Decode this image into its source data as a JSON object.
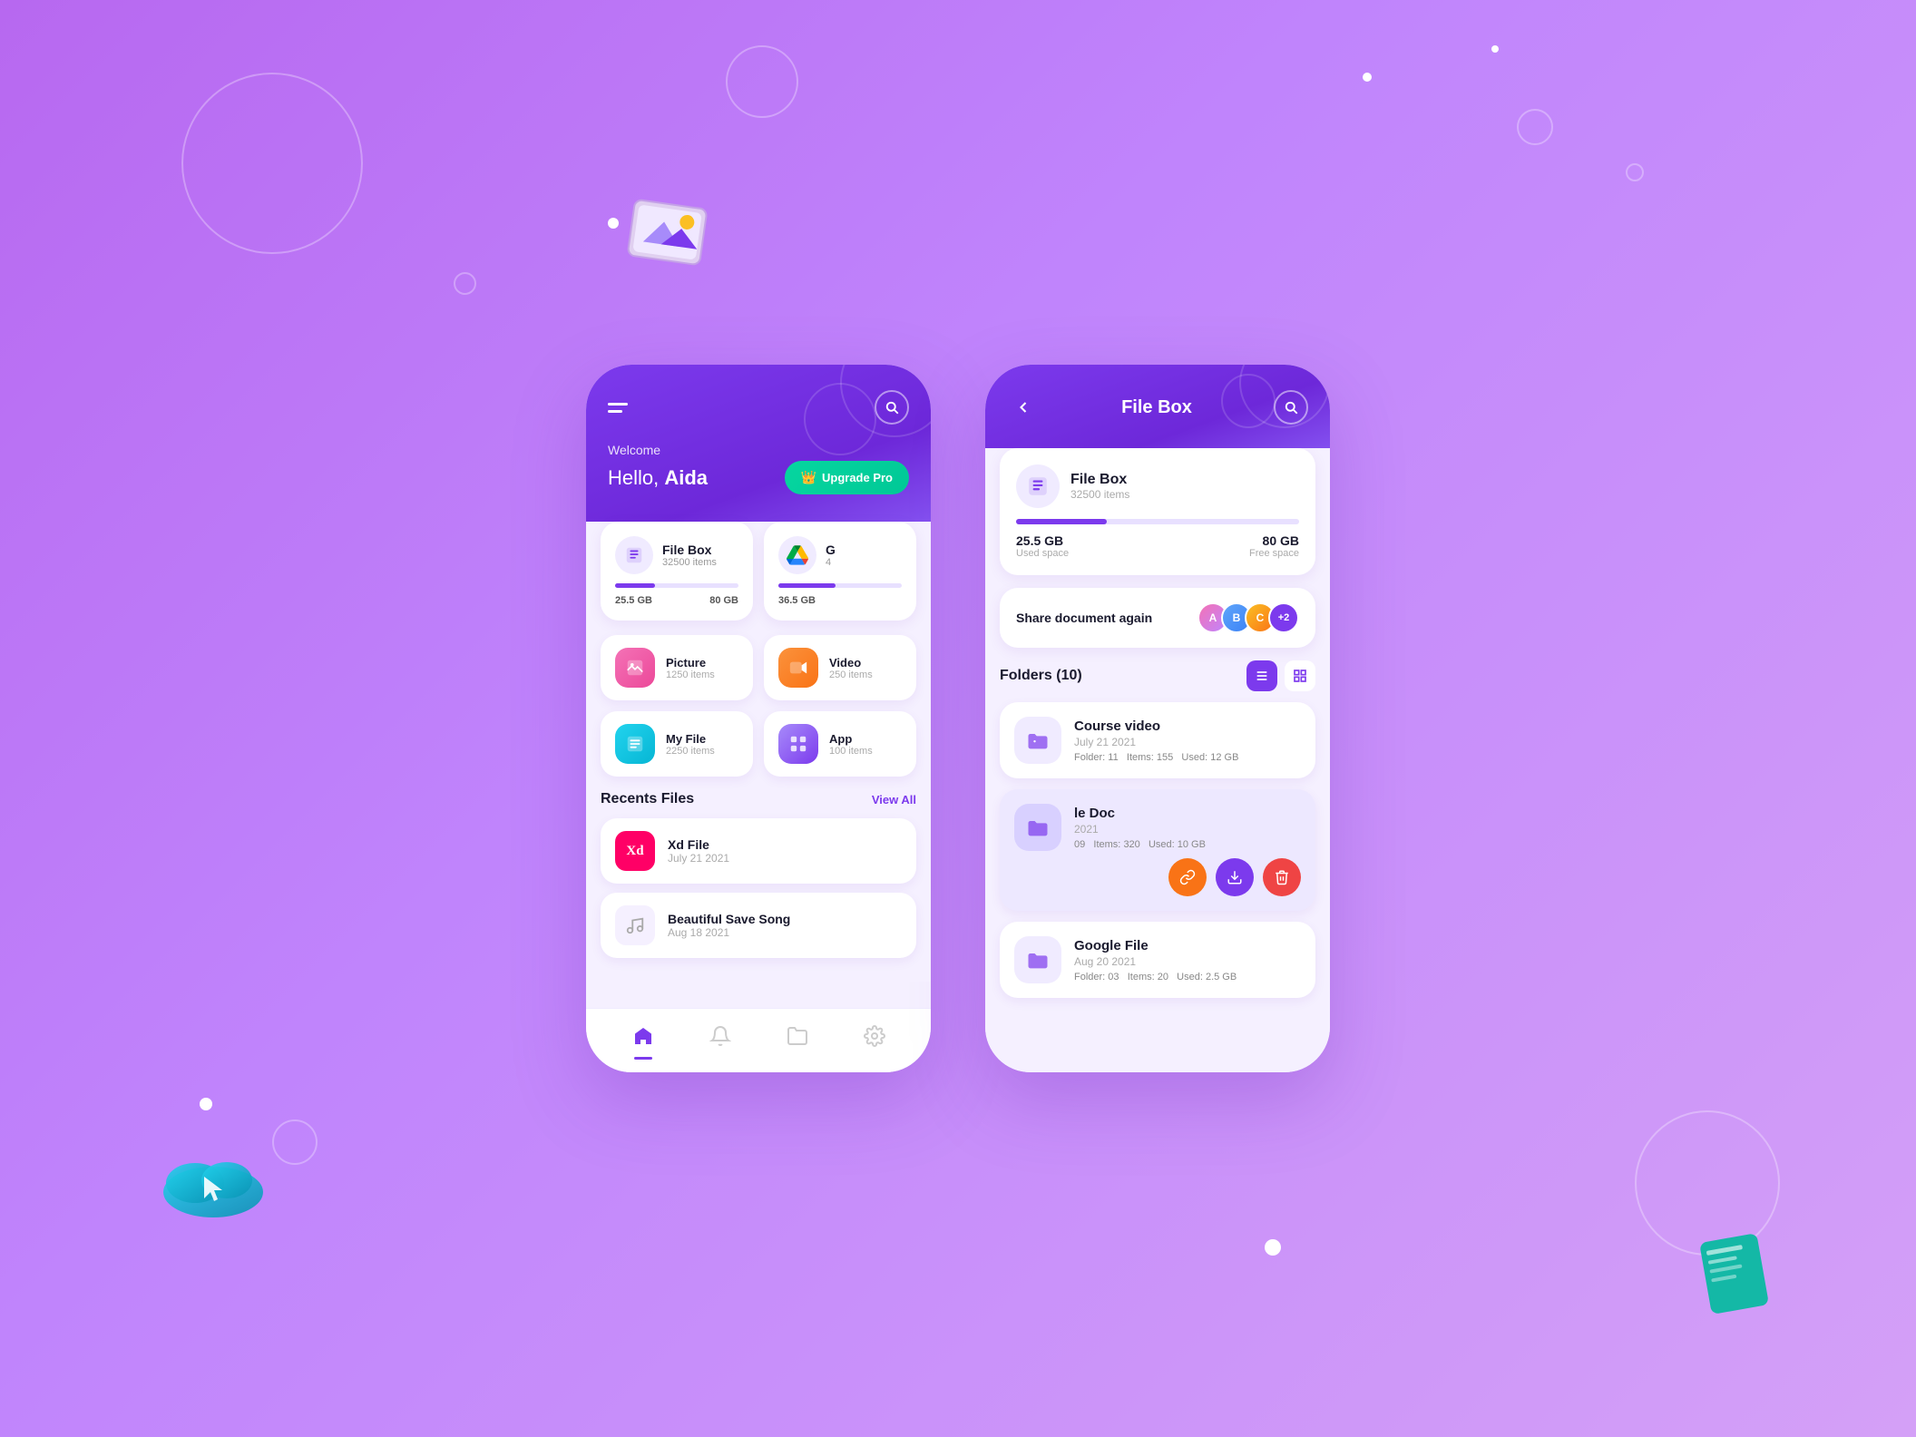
{
  "background": {
    "color": "#c084fc"
  },
  "left_phone": {
    "header": {
      "welcome": "Welcome",
      "hello_prefix": "Hello, ",
      "hello_name": "Aida",
      "upgrade_btn": "Upgrade Pro"
    },
    "storage_cards": [
      {
        "icon": "📄",
        "title": "File Box",
        "subtitle": "32500 items",
        "used_gb": "25.5 GB",
        "free_gb": "80 GB",
        "bar_percent": 32
      },
      {
        "icon": "△",
        "title": "G",
        "subtitle": "4",
        "used_gb": "36.5 GB",
        "free_gb": "",
        "bar_percent": 46
      }
    ],
    "categories": [
      {
        "icon": "🖼",
        "icon_class": "cat-icon-pink",
        "name": "Picture",
        "count": "1250 items"
      },
      {
        "icon": "🎬",
        "icon_class": "cat-icon-orange",
        "name": "Video",
        "count": "250 items"
      },
      {
        "icon": "📋",
        "icon_class": "cat-icon-cyan",
        "name": "My File",
        "count": "2250 items"
      },
      {
        "icon": "⊞",
        "icon_class": "cat-icon-purple",
        "name": "App",
        "count": "100 items"
      }
    ],
    "recents_title": "Recents Files",
    "view_all": "View All",
    "recent_files": [
      {
        "icon_text": "Xd",
        "icon_class": "xd-icon",
        "name": "Xd File",
        "date": "July 21 2021"
      },
      {
        "icon_text": "♪",
        "icon_class": "music-icon",
        "name": "Beautiful Save Song",
        "date": "Aug 18 2021"
      }
    ],
    "nav": {
      "items": [
        "🏠",
        "🔔",
        "📁",
        "⚙️"
      ]
    }
  },
  "right_phone": {
    "header": {
      "title": "File Box",
      "back": "<",
      "search_aria": "search"
    },
    "filebox": {
      "icon": "📄",
      "title": "File Box",
      "subtitle": "32500 items",
      "used_gb": "25.5 GB",
      "used_label": "Used space",
      "free_gb": "80 GB",
      "free_label": "Free space",
      "bar_percent": 32
    },
    "share": {
      "text": "Share document again",
      "count_extra": "+2"
    },
    "folders_label": "Folders (10)",
    "folders": [
      {
        "id": 1,
        "icon": "📁",
        "name": "Course video",
        "date": "July 21 2021",
        "folder_count": "11",
        "items": "155",
        "used": "12 GB",
        "show_actions": false
      },
      {
        "id": 2,
        "icon": "📁",
        "name": "le Doc",
        "date": "2021",
        "folder_count": "09",
        "items": "320",
        "used": "10 GB",
        "show_actions": true
      },
      {
        "id": 3,
        "icon": "📁",
        "name": "Google File",
        "date": "Aug 20 2021",
        "folder_count": "03",
        "items": "20",
        "used": "2.5 GB",
        "show_actions": false
      }
    ],
    "actions": {
      "link": "🔗",
      "download": "⬇",
      "delete": "🗑"
    }
  }
}
